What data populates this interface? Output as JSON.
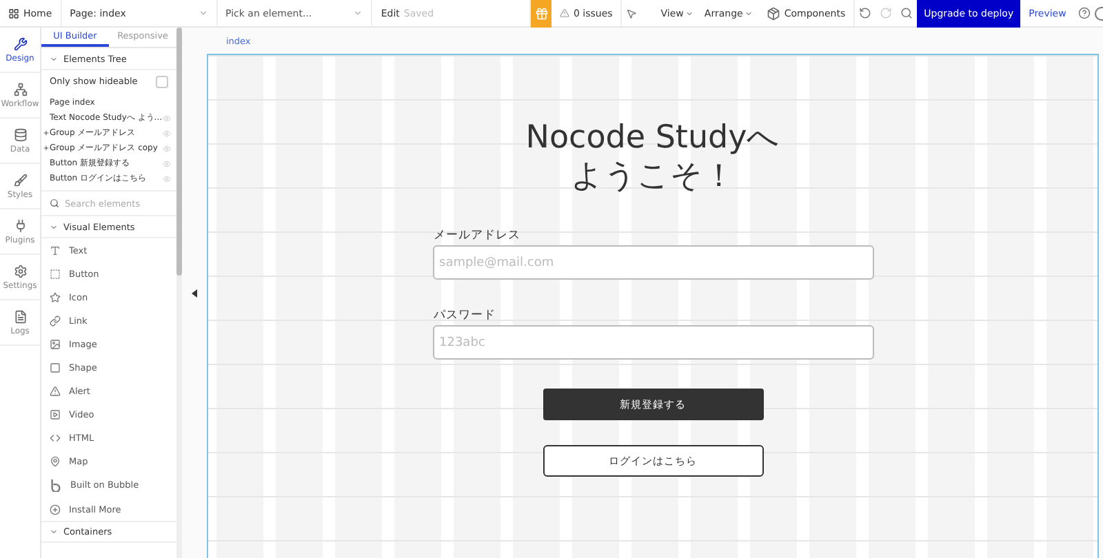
{
  "topbar": {
    "home": "Home",
    "page_select": "Page: index",
    "element_select": "Pick an element...",
    "edit": "Edit",
    "saved": "Saved",
    "issues": "0 issues",
    "view": "View",
    "arrange": "Arrange",
    "components": "Components",
    "upgrade": "Upgrade to deploy",
    "preview": "Preview"
  },
  "rail": [
    {
      "label": "Design",
      "selected": true
    },
    {
      "label": "Workflow",
      "selected": false
    },
    {
      "label": "Data",
      "selected": false
    },
    {
      "label": "Styles",
      "selected": false
    },
    {
      "label": "Plugins",
      "selected": false
    },
    {
      "label": "Settings",
      "selected": false
    },
    {
      "label": "Logs",
      "selected": false
    }
  ],
  "panel_tabs": [
    {
      "label": "UI Builder",
      "selected": true
    },
    {
      "label": "Responsive",
      "selected": false
    }
  ],
  "elements_tree": {
    "title": "Elements Tree",
    "hideable_label": "Only show hideable",
    "hideable_checked": false,
    "items": [
      {
        "kind": "page",
        "label": "Page index"
      },
      {
        "kind": "item",
        "label": "Text Nocode Studyへ よう..."
      },
      {
        "kind": "group",
        "label": "Group メールアドレス"
      },
      {
        "kind": "group",
        "label": "Group メールアドレス copy"
      },
      {
        "kind": "item",
        "label": "Button 新規登録する"
      },
      {
        "kind": "item",
        "label": "Button ログインはこちら"
      }
    ]
  },
  "search": {
    "placeholder": "Search elements"
  },
  "visual_elements": {
    "title": "Visual Elements",
    "items": [
      {
        "kind": "text",
        "label": "Text"
      },
      {
        "kind": "button",
        "label": "Button"
      },
      {
        "kind": "icon",
        "label": "Icon"
      },
      {
        "kind": "link",
        "label": "Link"
      },
      {
        "kind": "image",
        "label": "Image"
      },
      {
        "kind": "shape",
        "label": "Shape"
      },
      {
        "kind": "alert",
        "label": "Alert"
      },
      {
        "kind": "video",
        "label": "Video"
      },
      {
        "kind": "html",
        "label": "HTML"
      },
      {
        "kind": "map",
        "label": "Map"
      },
      {
        "kind": "bubble",
        "label": "Built on Bubble"
      },
      {
        "kind": "install",
        "label": "Install More"
      }
    ]
  },
  "containers": {
    "title": "Containers"
  },
  "canvas": {
    "page_label": "index",
    "title_line_1": "Nocode Studyへ",
    "title_line_2": "ようこそ！",
    "email_label": "メールアドレス",
    "email_placeholder": "sample@mail.com",
    "password_label": "パスワード",
    "password_placeholder": "123abc",
    "signup_button": "新規登録する",
    "login_button": "ログインはこちら"
  }
}
